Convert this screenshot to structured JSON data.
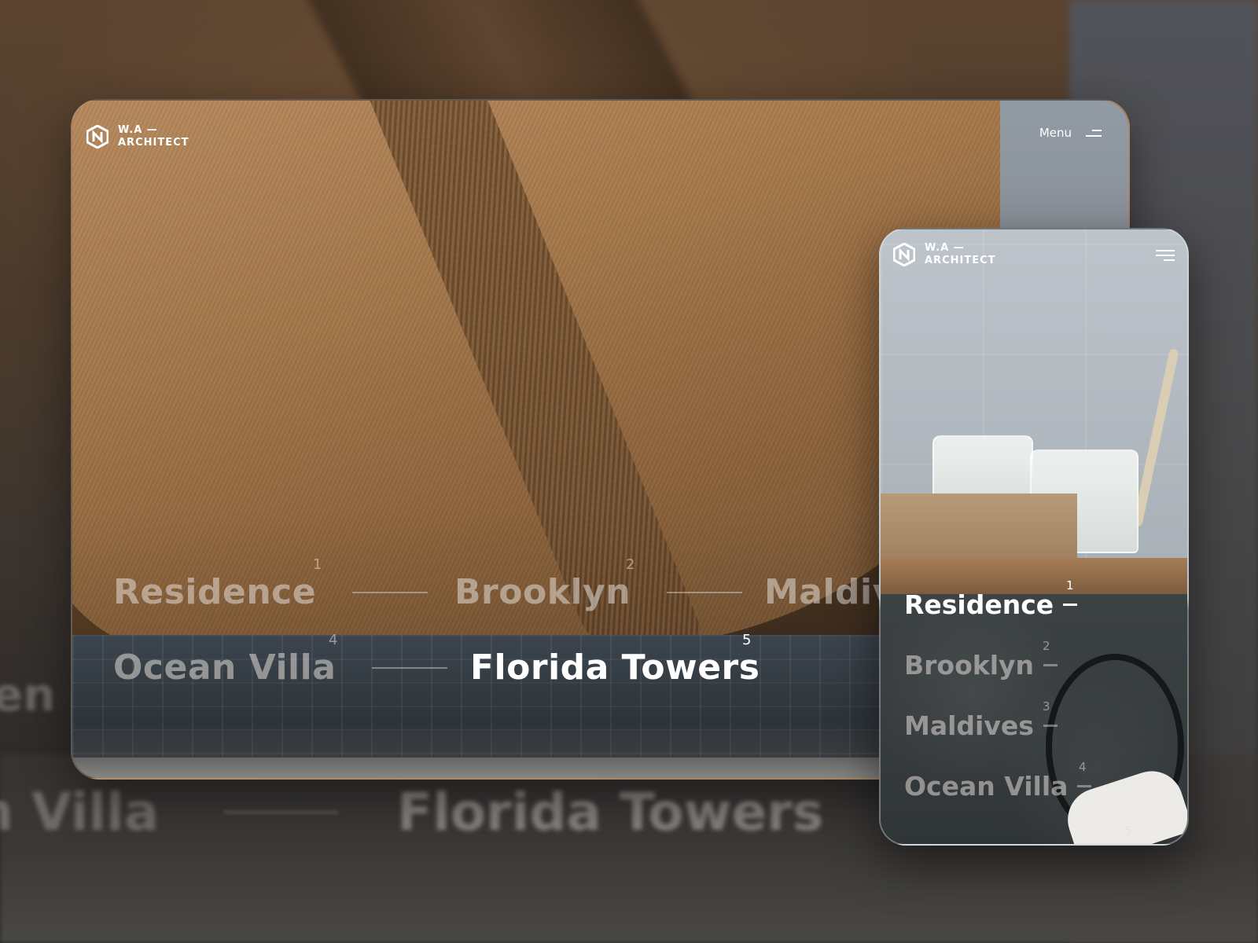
{
  "brand": {
    "line1": "W.A —",
    "line2": "ARCHITECT"
  },
  "desktop": {
    "menu_label": "Menu",
    "projects": [
      {
        "name": "Residence",
        "number": "1"
      },
      {
        "name": "Brooklyn",
        "number": "2"
      },
      {
        "name": "Maldiv",
        "number": ""
      },
      {
        "name": "Ocean Villa",
        "number": "4"
      },
      {
        "name": "Florida Towers",
        "number": "5"
      }
    ],
    "active_project": "Florida Towers"
  },
  "mobile": {
    "projects": [
      {
        "name": "Residence",
        "number": "1"
      },
      {
        "name": "Brooklyn",
        "number": "2"
      },
      {
        "name": "Maldives",
        "number": "3"
      },
      {
        "name": "Ocean Villa",
        "number": "4"
      }
    ],
    "next_number": "5",
    "active_project": "Residence"
  },
  "background": {
    "ghost_left_top": "len",
    "ghost_left_bottom": "n Villa",
    "ghost_center": "Florida Towers"
  },
  "icons": {
    "logo": "hexagon-logo-icon",
    "menu": "menu-icon",
    "hamburger": "hamburger-icon"
  }
}
